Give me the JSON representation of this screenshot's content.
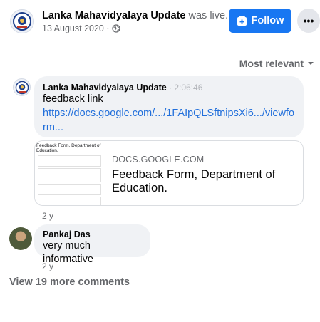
{
  "post": {
    "page_name": "Lanka Mahavidyalaya Update",
    "status": " was live.",
    "date": "13 August 2020 ·",
    "audience_icon": "globe-icon",
    "follow_label": "Follow",
    "more_label": "•••"
  },
  "comments_header": {
    "sort_label": "Most relevant"
  },
  "comments": [
    {
      "author": "Lanka Mahavidyalaya Update",
      "sep": " · ",
      "time": "2:06:46",
      "text": "feedback link",
      "link": "https://docs.google.com/.../1FAIpQLSftnipsXi6.../viewform...",
      "age": "2 y",
      "preview": {
        "domain": "DOCS.GOOGLE.COM",
        "title": "Feedback Form, Department of Education.",
        "thumb_title": "Feedback Form, Department of Education."
      }
    },
    {
      "author": "Pankaj Das",
      "text": "very much informative",
      "age": "2 y"
    }
  ],
  "view_more_label": "View 19 more comments",
  "colors": {
    "accent": "#1877f2",
    "link": "#216fdb",
    "bubble": "#f0f2f5",
    "muted": "#65676b"
  }
}
